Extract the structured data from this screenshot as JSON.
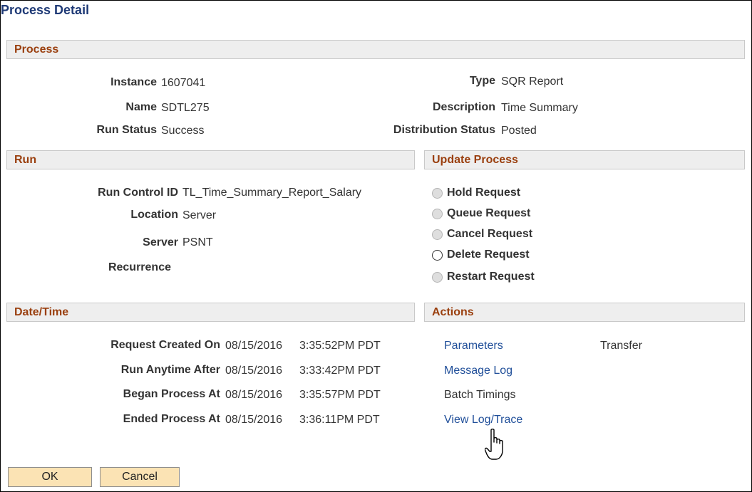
{
  "page_title": "Process Detail",
  "process": {
    "header": "Process",
    "instance_label": "Instance",
    "instance_value": "1607041",
    "name_label": "Name",
    "name_value": "SDTL275",
    "run_status_label": "Run Status",
    "run_status_value": "Success",
    "type_label": "Type",
    "type_value": "SQR Report",
    "description_label": "Description",
    "description_value": "Time Summary",
    "dist_status_label": "Distribution Status",
    "dist_status_value": "Posted"
  },
  "run": {
    "header": "Run",
    "run_control_label": "Run Control ID",
    "run_control_value": "TL_Time_Summary_Report_Salary",
    "location_label": "Location",
    "location_value": "Server",
    "server_label": "Server",
    "server_value": "PSNT",
    "recurrence_label": "Recurrence",
    "recurrence_value": ""
  },
  "update_process": {
    "header": "Update Process",
    "options": [
      {
        "label": "Hold Request",
        "enabled": false
      },
      {
        "label": "Queue Request",
        "enabled": false
      },
      {
        "label": "Cancel Request",
        "enabled": false
      },
      {
        "label": "Delete Request",
        "enabled": true
      },
      {
        "label": "Restart Request",
        "enabled": false
      }
    ]
  },
  "datetime": {
    "header": "Date/Time",
    "rows": [
      {
        "label": "Request Created On",
        "date": "08/15/2016",
        "time": "3:35:52PM PDT"
      },
      {
        "label": "Run Anytime After",
        "date": "08/15/2016",
        "time": "3:33:42PM PDT"
      },
      {
        "label": "Began Process At",
        "date": "08/15/2016",
        "time": "3:35:57PM PDT"
      },
      {
        "label": "Ended Process At",
        "date": "08/15/2016",
        "time": "3:36:11PM PDT"
      }
    ]
  },
  "actions": {
    "header": "Actions",
    "parameters": "Parameters",
    "transfer": "Transfer",
    "message_log": "Message Log",
    "batch_timings": "Batch Timings",
    "view_log_trace": "View Log/Trace"
  },
  "buttons": {
    "ok": "OK",
    "cancel": "Cancel"
  },
  "colors": {
    "title": "#1f3a76",
    "section_header_text": "#9a3f0e",
    "link": "#1f4e99",
    "button_bg": "#fbe3b4"
  },
  "icons": {
    "cursor": "hand-pointer-icon"
  }
}
